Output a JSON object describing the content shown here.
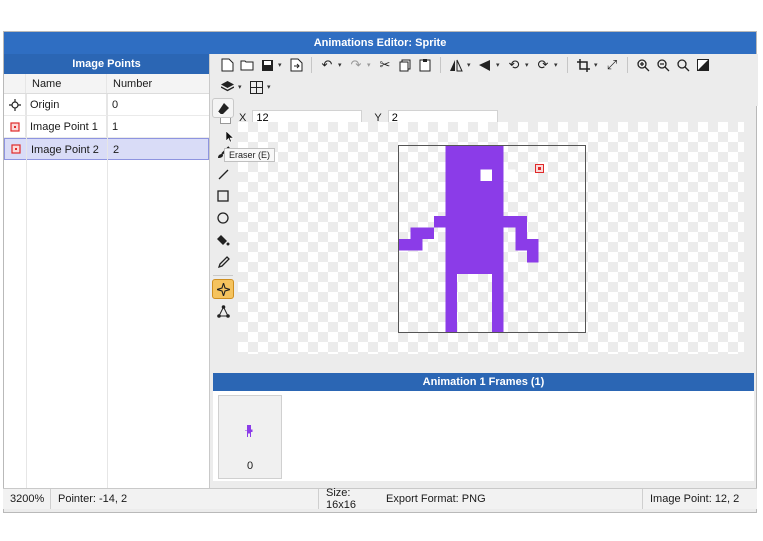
{
  "window": {
    "title": "Animations Editor: Sprite"
  },
  "image_points": {
    "header": "Image Points",
    "columns": [
      "Name",
      "Number"
    ],
    "rows": [
      {
        "name": "Origin",
        "number": "0",
        "icon": "crosshair-icon"
      },
      {
        "name": "Image Point 1",
        "number": "1",
        "icon": "point-marker-icon"
      },
      {
        "name": "Image Point 2",
        "number": "2",
        "icon": "point-marker-icon",
        "selected": true
      }
    ]
  },
  "coords": {
    "x_label": "X",
    "x_value": "12",
    "y_label": "Y",
    "y_value": "2"
  },
  "tooltip": "Eraser (E)",
  "frames": {
    "header": "Animation 1 Frames (1)",
    "items": [
      "0"
    ]
  },
  "status": {
    "zoom": "3200%",
    "pointer": "Pointer: -14, 2",
    "size": "Size: 16x16",
    "format": "Export Format: PNG",
    "image_point": "Image Point: 12, 2"
  },
  "colors": {
    "accent": "#2b66b4",
    "sprite": "#8b3ce8",
    "active_tool": "#f5c35e"
  }
}
